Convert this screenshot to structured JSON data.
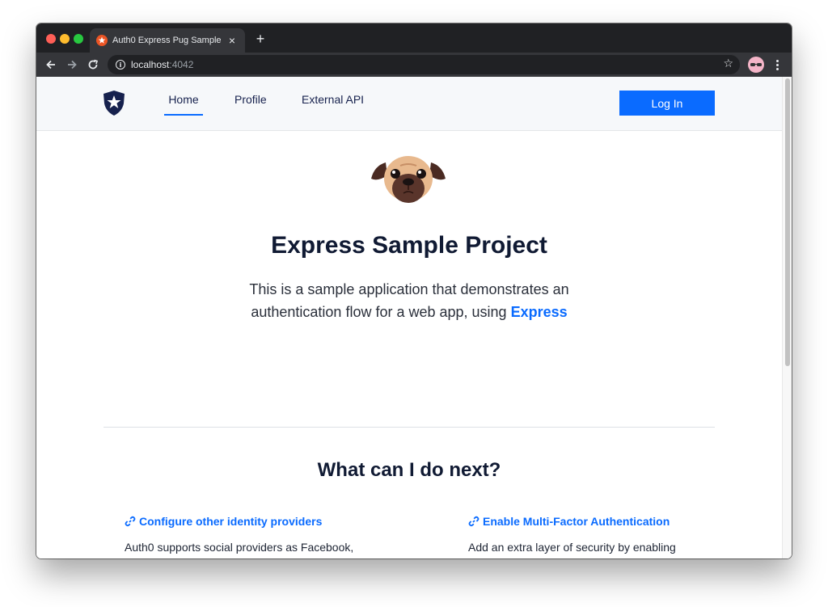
{
  "browser": {
    "tab_title": "Auth0 Express Pug Sample",
    "tab_close": "×",
    "new_tab": "+",
    "url_host": "localhost",
    "url_port": ":4042",
    "info_icon": "i",
    "star_icon": "☆"
  },
  "nav": {
    "items": [
      {
        "label": "Home",
        "active": true
      },
      {
        "label": "Profile",
        "active": false
      },
      {
        "label": "External API",
        "active": false
      }
    ],
    "login_label": "Log In"
  },
  "hero": {
    "title": "Express Sample Project",
    "lead_text": "This is a sample application that demonstrates an authentication flow for a web app, using ",
    "lead_link": "Express"
  },
  "next_steps": {
    "title": "What can I do next?",
    "cards": [
      {
        "title": "Configure other identity providers",
        "text": "Auth0 supports social providers as Facebook,"
      },
      {
        "title": "Enable Multi-Factor Authentication",
        "text": "Add an extra layer of security by enabling"
      }
    ]
  },
  "colors": {
    "accent": "#0a6bff",
    "heading": "#101a33",
    "nav_bg": "#f6f8fa"
  },
  "icons": {
    "logo": "auth0-shield-icon",
    "hero": "pug-icon",
    "card_link": "link-icon"
  }
}
